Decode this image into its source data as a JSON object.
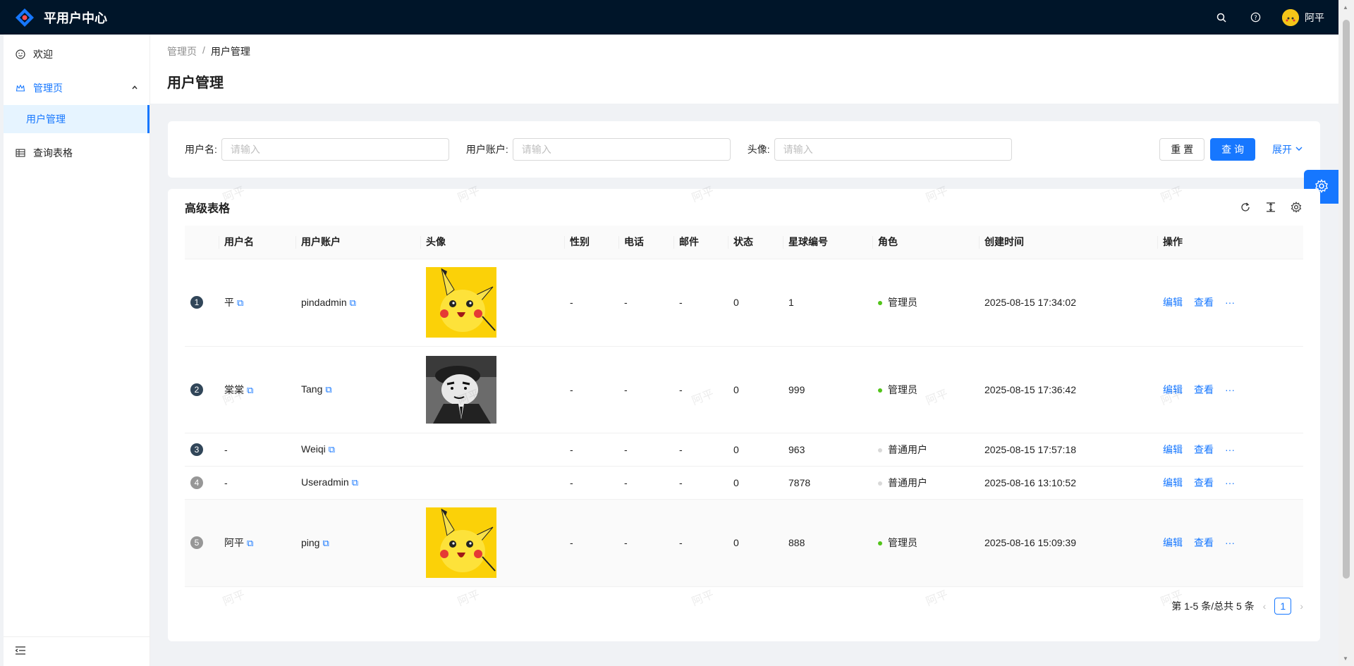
{
  "header": {
    "app_title": "平用户中心",
    "username": "阿平",
    "search_icon": "search-icon",
    "help_icon": "question-icon"
  },
  "sidebar": {
    "items": [
      {
        "label": "欢迎",
        "icon": "smile-icon"
      },
      {
        "label": "管理页",
        "icon": "crown-icon"
      },
      {
        "label": "用户管理"
      },
      {
        "label": "查询表格",
        "icon": "table-icon"
      }
    ]
  },
  "breadcrumb": {
    "parent": "管理页",
    "separator": "/",
    "current": "用户管理"
  },
  "page_title": "用户管理",
  "search": {
    "username_label": "用户名:",
    "account_label": "用户账户:",
    "avatar_label": "头像:",
    "placeholder": "请输入",
    "reset_label": "重 置",
    "query_label": "查 询",
    "expand_label": "展开"
  },
  "table": {
    "title": "高级表格",
    "columns": [
      "",
      "用户名",
      "用户账户",
      "头像",
      "性别",
      "电话",
      "邮件",
      "状态",
      "星球编号",
      "角色",
      "创建时间",
      "操作"
    ],
    "rows": [
      {
        "index": "1",
        "username": "平",
        "account": "pindadmin",
        "avatar": "pikachu",
        "gender": "-",
        "phone": "-",
        "email": "-",
        "status": "0",
        "planet": "1",
        "role": "管理员",
        "role_color": "#52c41a",
        "created": "2025-08-15 17:34:02"
      },
      {
        "index": "2",
        "username": "棠棠",
        "account": "Tang",
        "avatar": "crayon",
        "gender": "-",
        "phone": "-",
        "email": "-",
        "status": "0",
        "planet": "999",
        "role": "管理员",
        "role_color": "#52c41a",
        "created": "2025-08-15 17:36:42"
      },
      {
        "index": "3",
        "username": "-",
        "account": "Weiqi",
        "avatar": "",
        "gender": "-",
        "phone": "-",
        "email": "-",
        "status": "0",
        "planet": "963",
        "role": "普通用户",
        "role_color": "#d9d9d9",
        "created": "2025-08-15 17:57:18"
      },
      {
        "index": "4",
        "username": "-",
        "account": "Useradmin",
        "avatar": "",
        "gender": "-",
        "phone": "-",
        "email": "-",
        "status": "0",
        "planet": "7878",
        "role": "普通用户",
        "role_color": "#d9d9d9",
        "created": "2025-08-16 13:10:52"
      },
      {
        "index": "5",
        "username": "阿平",
        "account": "ping",
        "avatar": "pikachu",
        "gender": "-",
        "phone": "-",
        "email": "-",
        "status": "0",
        "planet": "888",
        "role": "管理员",
        "role_color": "#52c41a",
        "created": "2025-08-16 15:09:39"
      }
    ],
    "actions": {
      "edit": "编辑",
      "view": "查看",
      "more": "···"
    }
  },
  "pagination": {
    "summary": "第 1-5 条/总共 5 条",
    "current_page": "1"
  },
  "watermark": "阿平"
}
